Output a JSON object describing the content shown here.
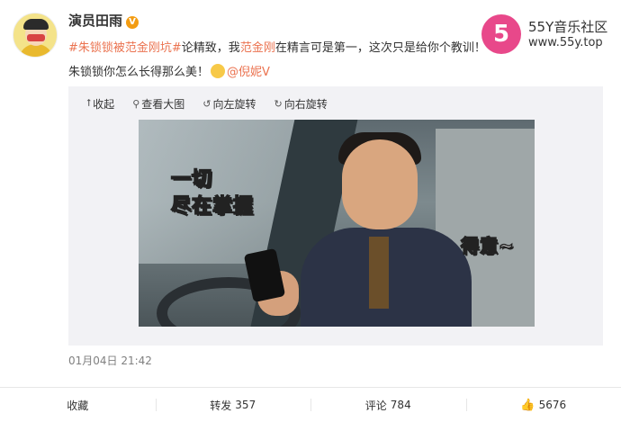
{
  "post": {
    "username": "演员田雨",
    "verified_badge": "V",
    "text_topic": "#朱锁锁被范金刚坑#",
    "text_part1": "论精致，我",
    "text_name": "范金刚",
    "text_part2": "在精言可是第一，这次只是给你个教训！朱锁锁你怎么长得那么美！",
    "mention": "@倪妮V",
    "time": "01月04日 21:42"
  },
  "watermark": {
    "logo_char": "5",
    "title": "55Y音乐社区",
    "url": "www.55y.top"
  },
  "media_toolbar": {
    "collapse": "收起",
    "view_large": "查看大图",
    "rotate_left": "向左旋转",
    "rotate_right": "向右旋转"
  },
  "image_captions": {
    "line1": "一切",
    "line2": "尽在掌握",
    "line3": "得意~"
  },
  "actions": {
    "favorite": "收藏",
    "repost_label": "转发",
    "repost_count": "357",
    "comment_label": "评论",
    "comment_count": "784",
    "like_count": "5676"
  },
  "icons": {
    "collapse": "arrow-up-icon",
    "view_large": "magnifier-icon",
    "rotate_left": "rotate-left-icon",
    "rotate_right": "rotate-right-icon",
    "like": "thumbs-up-icon"
  },
  "colors": {
    "link": "#eb7350",
    "verified": "#f39c12",
    "watermark_logo": "#e8488a"
  }
}
